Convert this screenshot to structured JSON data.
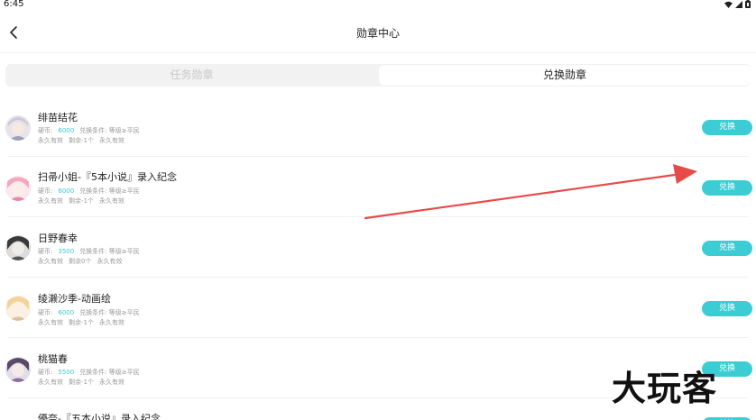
{
  "status_bar": {
    "time": "6:45",
    "icons": [
      "wifi-icon",
      "signal-icon",
      "battery-icon"
    ]
  },
  "header": {
    "title": "勋章中心",
    "back_icon": "chevron-left-icon"
  },
  "tabs": [
    {
      "label": "任务勋章",
      "active": false
    },
    {
      "label": "兑换勋章",
      "active": true
    }
  ],
  "medals": [
    {
      "name": "绯苗结花",
      "price_label": "硬币:",
      "price": "6000",
      "condition": "兑换条件: 等级≥平民",
      "validity": "永久有效",
      "remaining": "剩余-1个",
      "duration": "永久有效",
      "button": "兑换"
    },
    {
      "name": "扫帚小姐-『5本小说』录入纪念",
      "price_label": "硬币:",
      "price": "6000",
      "condition": "兑换条件: 等级≥平民",
      "validity": "永久有效",
      "remaining": "剩余-1个",
      "duration": "永久有效",
      "button": "兑换"
    },
    {
      "name": "日野春幸",
      "price_label": "硬币:",
      "price": "3500",
      "condition": "兑换条件: 等级≥平民",
      "validity": "永久有效",
      "remaining": "剩余0个",
      "duration": "永久有效",
      "button": "兑换"
    },
    {
      "name": "绫濑沙季-动画绘",
      "price_label": "硬币:",
      "price": "6000",
      "condition": "兑换条件: 等级≥平民",
      "validity": "永久有效",
      "remaining": "剩余-1个",
      "duration": "永久有效",
      "button": "兑换"
    },
    {
      "name": "桃猫春",
      "price_label": "硬币:",
      "price": "5500",
      "condition": "兑换条件: 等级≥平民",
      "validity": "永久有效",
      "remaining": "剩余-1个",
      "duration": "永久有效",
      "button": "兑换"
    },
    {
      "name": "優奈-『五本小说』录入纪念",
      "button": "兑换"
    }
  ],
  "colors": {
    "accent": "#3ccdd4",
    "price": "#3cc8d0",
    "annotation_arrow": "#e84a4a",
    "inactive_tab_text": "#c8c8c8"
  },
  "watermark": "大玩客"
}
